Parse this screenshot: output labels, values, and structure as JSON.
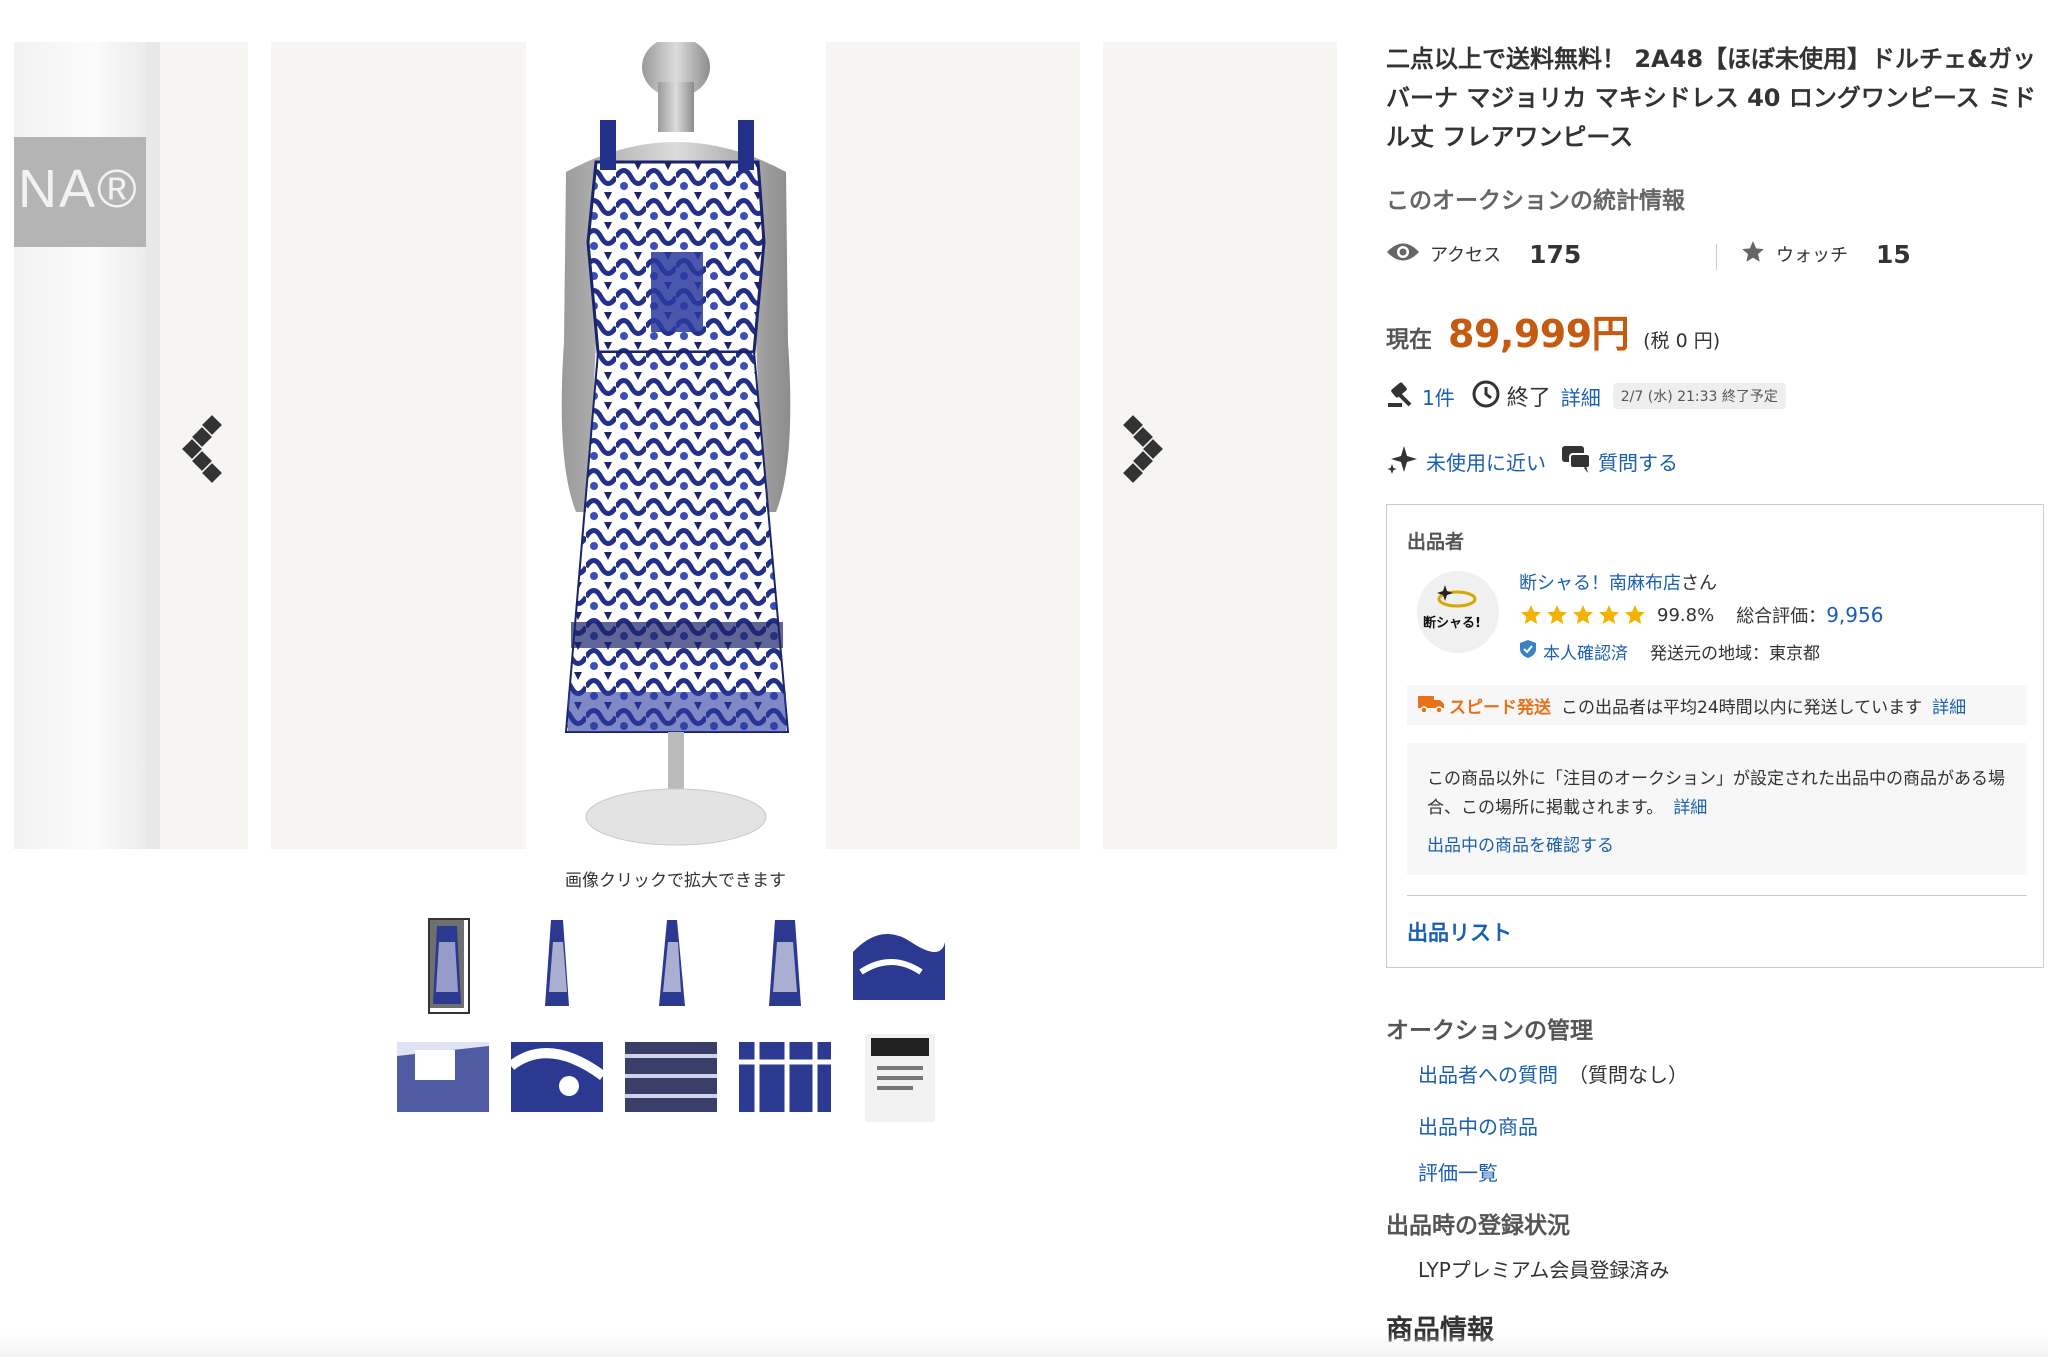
{
  "gallery": {
    "label_text": "NA®",
    "caption": "画像クリックで拡大できます",
    "thumbnail_count": 10
  },
  "title": "二点以上で送料無料！ 2A48【ほぼ未使用】ドルチェ&ガッバーナ マジョリカ マキシドレス 40 ロングワンピース ミドル丈 フレアワンピース",
  "stats": {
    "heading": "このオークションの統計情報",
    "access_label": "アクセス",
    "access_count": "175",
    "watch_label": "ウォッチ",
    "watch_count": "15"
  },
  "price": {
    "label": "現在",
    "value": "89,999円",
    "tax": "(税 0 円)"
  },
  "bid": {
    "count": "1件",
    "end_label": "終了",
    "detail_link": "詳細",
    "end_date": "2/7 (水) 21:33 終了予定"
  },
  "features": {
    "condition": "未使用に近い",
    "question": "質問する"
  },
  "seller": {
    "heading": "出品者",
    "avatar_text": "断シャる!",
    "name": "断シャる！南麻布店",
    "name_suffix": "さん",
    "rating_pct": "99.8%",
    "total_label": "総合評価：",
    "total_value": "9,956",
    "verified": "本人確認済",
    "region": "発送元の地域：東京都",
    "speed_label": "スピード発送",
    "speed_text": "この出品者は平均24時間以内に発送しています",
    "speed_link": "詳細",
    "notice_text": "この商品以外に「注目のオークション」が設定された出品中の商品がある場合、この場所に掲載されます。",
    "notice_detail": "詳細",
    "notice_link": "出品中の商品を確認する",
    "list_link": "出品リスト"
  },
  "management": {
    "heading": "オークションの管理",
    "question_link": "出品者への質問",
    "question_note": "（質問なし）",
    "listing_link": "出品中の商品",
    "review_link": "評価一覧"
  },
  "registration": {
    "heading": "出品時の登録状況",
    "value": "LYPプレミアム会員登録済み"
  },
  "info_heading": "商品情報",
  "colors": {
    "link": "#1a5fb4",
    "price": "#c55a11",
    "speed": "#e8711a",
    "star": "#f5b301"
  }
}
